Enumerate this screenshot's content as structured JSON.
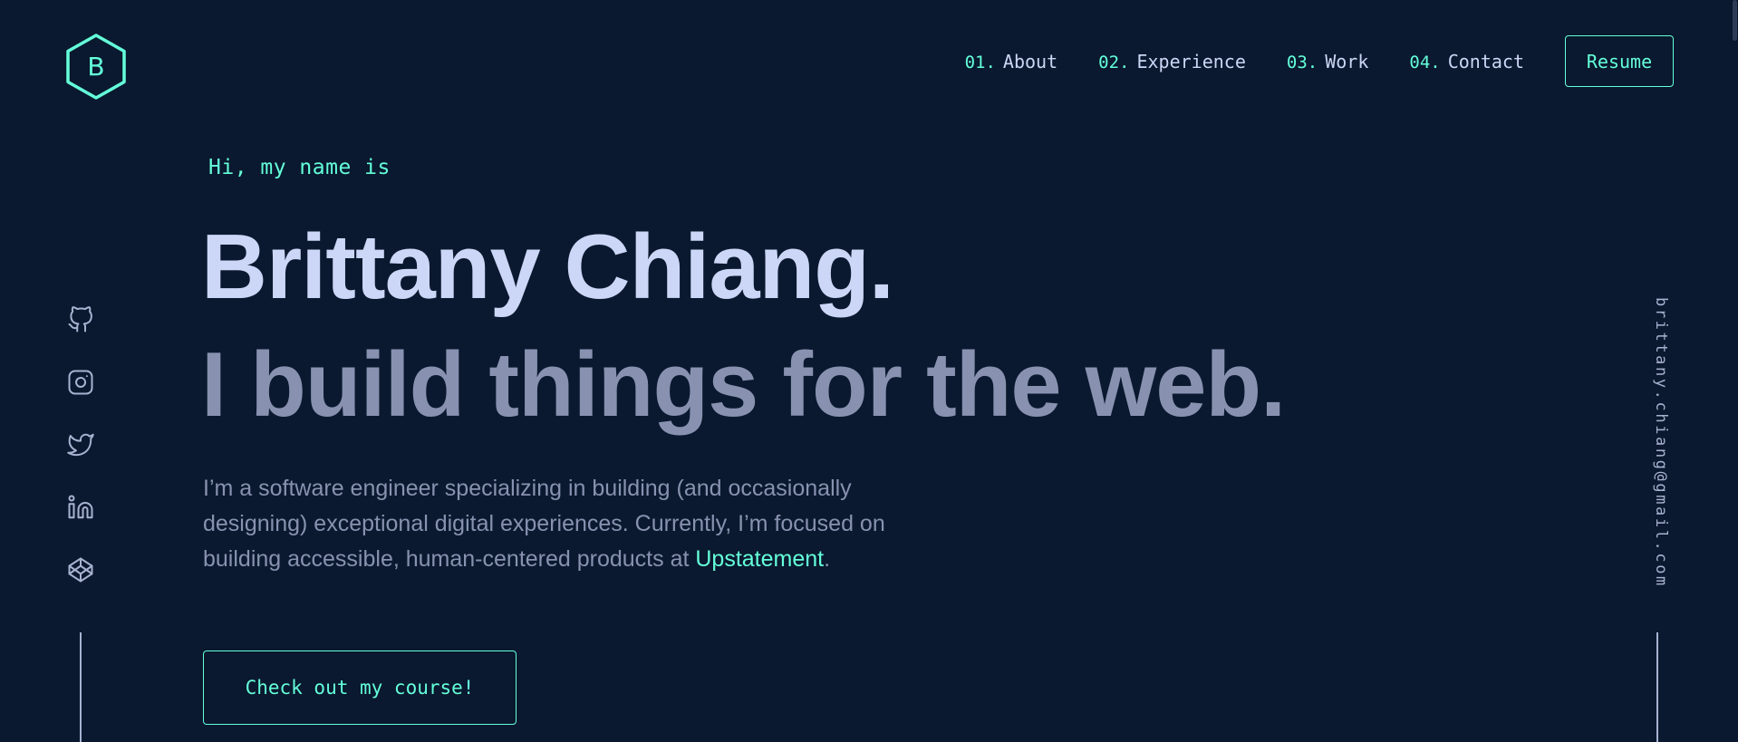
{
  "logo": {
    "letter": "B",
    "icon": "hexagon-logo-icon"
  },
  "nav": {
    "items": [
      {
        "num": "01.",
        "label": "About"
      },
      {
        "num": "02.",
        "label": "Experience"
      },
      {
        "num": "03.",
        "label": "Work"
      },
      {
        "num": "04.",
        "label": "Contact"
      }
    ],
    "resume_label": "Resume"
  },
  "hero": {
    "greeting": "Hi, my name is",
    "name": "Brittany Chiang.",
    "tagline": "I build things for the web.",
    "intro_before": "I’m a software engineer specializing in building (and occasionally designing) exceptional digital experiences. Currently, I’m focused on building accessible, human-centered products at ",
    "intro_link": "Upstatement",
    "intro_after": ".",
    "cta_label": "Check out my course!"
  },
  "social": {
    "icons": [
      "github-icon",
      "instagram-icon",
      "twitter-icon",
      "linkedin-icon",
      "codepen-icon"
    ]
  },
  "email": "brittany.chiang@gmail.com",
  "colors": {
    "background": "#0a192f",
    "accent": "#64ffda",
    "heading": "#ccd6f6",
    "muted": "#8892b0",
    "light": "#a8b2d1"
  }
}
